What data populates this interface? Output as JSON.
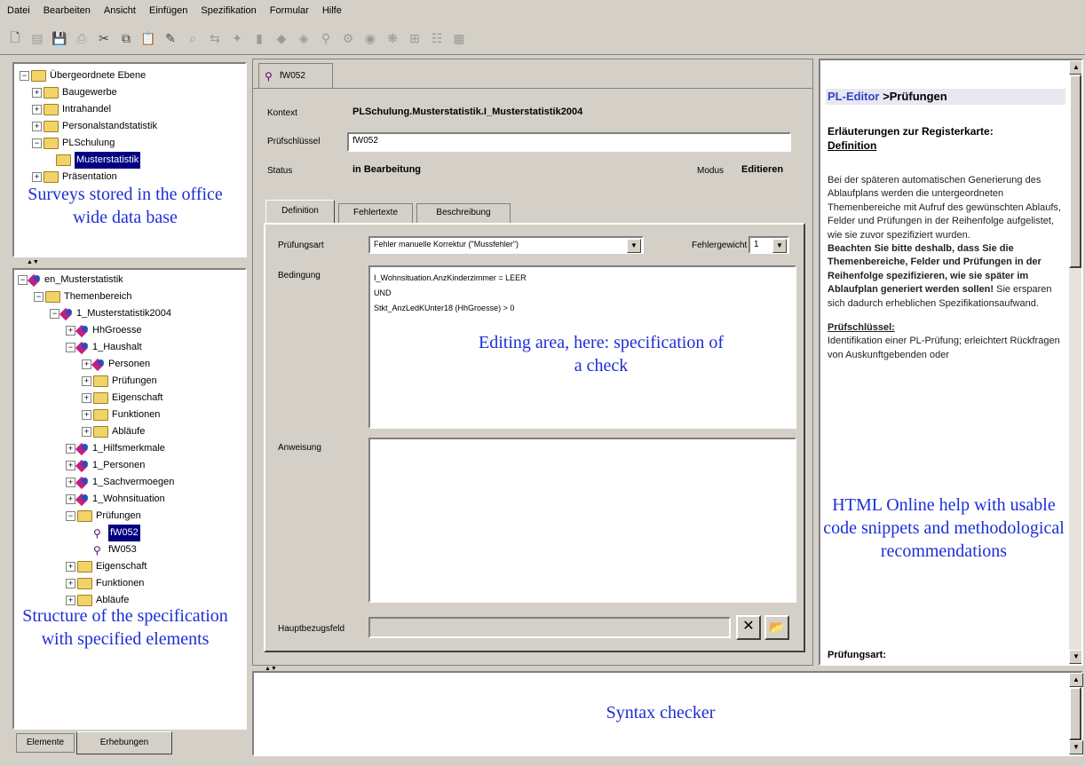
{
  "menu": [
    "Datei",
    "Bearbeiten",
    "Ansicht",
    "Einfügen",
    "Spezifikation",
    "Formular",
    "Hilfe"
  ],
  "surveys_tree": {
    "items": [
      {
        "label": "Übergeordnete Ebene",
        "level": 0
      },
      {
        "label": "Baugewerbe",
        "level": 1
      },
      {
        "label": "Intrahandel",
        "level": 1
      },
      {
        "label": "Personalstandstatistik",
        "level": 1
      },
      {
        "label": "PLSchulung",
        "level": 1
      },
      {
        "label": "Musterstatistik",
        "level": 2
      },
      {
        "label": "Präsentation",
        "level": 1
      }
    ],
    "annotation": "Surveys stored in the office wide data base"
  },
  "spec_tree": {
    "items": [
      {
        "label": "en_Musterstatistik",
        "level": 0
      },
      {
        "label": "Themenbereich",
        "level": 1
      },
      {
        "label": "1_Musterstatistik2004",
        "level": 2
      },
      {
        "label": "HhGroesse",
        "level": 3
      },
      {
        "label": "1_Haushalt",
        "level": 3
      },
      {
        "label": "Personen",
        "level": 4
      },
      {
        "label": "Prüfungen",
        "level": 4
      },
      {
        "label": "Eigenschaft",
        "level": 4
      },
      {
        "label": "Funktionen",
        "level": 4
      },
      {
        "label": "Abläufe",
        "level": 4
      },
      {
        "label": "1_Hilfsmerkmale",
        "level": 3
      },
      {
        "label": "1_Personen",
        "level": 3
      },
      {
        "label": "1_Sachvermoegen",
        "level": 3
      },
      {
        "label": "1_Wohnsituation",
        "level": 3
      },
      {
        "label": "Prüfungen",
        "level": 3
      },
      {
        "label": "fW052",
        "level": 4
      },
      {
        "label": "fW053",
        "level": 4
      },
      {
        "label": "Eigenschaft",
        "level": 3
      },
      {
        "label": "Funktionen",
        "level": 3
      },
      {
        "label": "Abläufe",
        "level": 3
      }
    ],
    "annotation": "Structure of the specification with specified elements"
  },
  "bottom_tabs": [
    "Elemente",
    "Erhebungen"
  ],
  "editor": {
    "doc_tab": "fW052",
    "kontext_label": "Kontext",
    "kontext_value": "PLSchulung.Musterstatistik.I_Musterstatistik2004",
    "pruefschluessel_label": "Prüfschlüssel",
    "pruefschluessel_value": "fW052",
    "status_label": "Status",
    "status_value": "in Bearbeitung",
    "modus_label": "Modus",
    "modus_value": "Editieren",
    "tabs": [
      "Definition",
      "Fehlertexte",
      "Beschreibung"
    ],
    "pruefungsart_label": "Prüfungsart",
    "pruefungsart_value": "Fehler manuelle Korrektur (\"Mussfehler\")",
    "fehlergewicht_label": "Fehlergewicht",
    "fehlergewicht_value": "1",
    "bedingung_label": "Bedingung",
    "bedingung_lines": [
      "I_Wohnsituation.AnzKinderzimmer = LEER",
      "UND",
      "Stkt_AnzLedKUnter18 (HhGroesse) > 0"
    ],
    "editing_annotation": "Editing area, here: specification of a check",
    "anweisung_label": "Anweisung",
    "hauptbezugsfeld_label": "Hauptbezugsfeld"
  },
  "help": {
    "title_link": "PL-Editor",
    "title_rest": " >Prüfungen",
    "heading": "Erläuterungen zur Registerkarte:",
    "heading_sub": "Definition",
    "para1": "Bei der späteren automatischen Generierung des Ablaufplans werden die untergeordneten Themenbereiche mit Aufruf des gewünschten Ablaufs, Felder und Prüfungen in der Reihenfolge aufgelistet, wie sie zuvor spezifiziert wurden.",
    "para2_bold": "Beachten Sie bitte deshalb, dass Sie die Themenbereiche, Felder und Prüfungen in der Reihenfolge spezifizieren, wie sie später im Ablaufplan generiert werden sollen!",
    "para2_rest": " Sie ersparen sich dadurch erheblichen Spezifikationsaufwand.",
    "section2": "Prüfschlüssel:",
    "para3": "Identifikation einer PL-Prüfung; erleichtert Rückfragen von Auskunftgebenden oder",
    "annotation": "HTML Online help with usable code snippets and methodological recommendations",
    "footer": "Prüfungsart:"
  },
  "syntax": {
    "annotation": "Syntax checker"
  }
}
